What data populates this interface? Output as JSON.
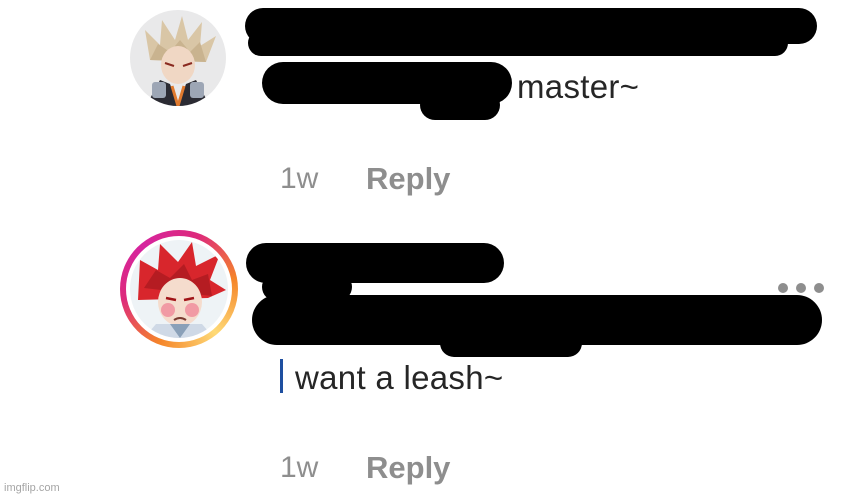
{
  "comments": [
    {
      "visible_text": "master~",
      "time": "1w",
      "reply_label": "Reply",
      "has_story_ring": false
    },
    {
      "visible_text": "want a leash~",
      "time": "1w",
      "reply_label": "Reply",
      "has_story_ring": true
    }
  ],
  "icons": {
    "more": "more-options-icon",
    "caret": "text-cursor"
  },
  "colors": {
    "text": "#262626",
    "secondary": "#8e8e8e",
    "redaction": "#000000",
    "caret": "#1e4fa0",
    "story_ring": [
      "#f58529",
      "#dd2a7b",
      "#d6249f",
      "#feda77"
    ]
  },
  "watermark": "imgflip.com"
}
